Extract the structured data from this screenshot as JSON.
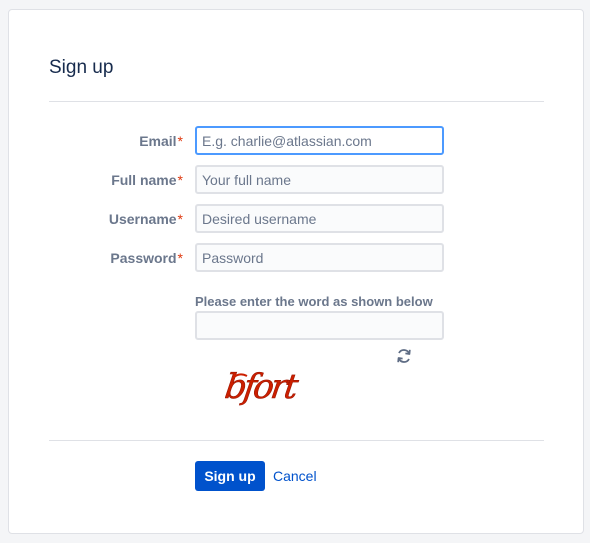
{
  "page": {
    "title": "Sign up"
  },
  "form": {
    "fields": [
      {
        "label": "Email",
        "required_mark": "*",
        "value": "",
        "placeholder": "E.g. charlie@atlassian.com"
      },
      {
        "label": "Full name",
        "required_mark": "*",
        "value": "",
        "placeholder": "Your full name"
      },
      {
        "label": "Username",
        "required_mark": "*",
        "value": "",
        "placeholder": "Desired username"
      },
      {
        "label": "Password",
        "required_mark": "*",
        "value": "",
        "placeholder": "Password"
      }
    ],
    "captcha": {
      "label": "Please enter the word as shown below",
      "value": "",
      "refresh_icon": "refresh-icon",
      "image_text": "bfort"
    },
    "actions": {
      "submit_label": "Sign up",
      "cancel_label": "Cancel"
    }
  },
  "colors": {
    "primary": "#0052cc",
    "required": "#de350b",
    "focus_border": "#4c9aff",
    "captcha_text": "#cc1f00"
  }
}
